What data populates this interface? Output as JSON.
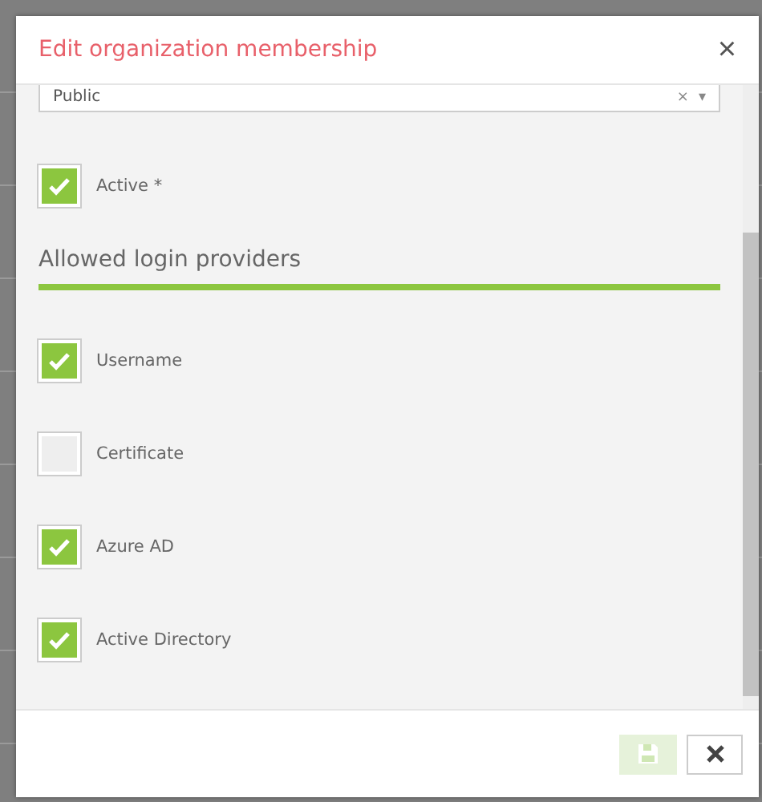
{
  "dialog": {
    "title": "Edit organization membership",
    "close": "×"
  },
  "visibility_select": {
    "value": "Public",
    "clear": "×",
    "caret": "▾"
  },
  "active": {
    "label": "Active *",
    "checked": true
  },
  "section": {
    "title": "Allowed login providers"
  },
  "providers": [
    {
      "label": "Username",
      "checked": true
    },
    {
      "label": "Certificate",
      "checked": false
    },
    {
      "label": "Azure AD",
      "checked": true
    },
    {
      "label": "Active Directory",
      "checked": true
    }
  ],
  "footer": {
    "save_disabled": true
  }
}
